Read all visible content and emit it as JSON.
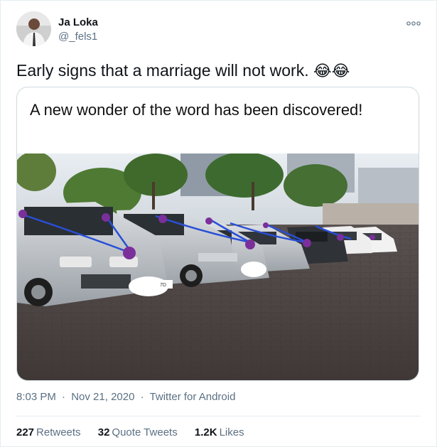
{
  "author": {
    "name": "Ja Loka",
    "handle": "@_fels1"
  },
  "tweet": {
    "text": "Early signs that a marriage will not work.",
    "emojis": [
      "😂",
      "😂"
    ]
  },
  "media": {
    "caption": "A new wonder of the word has been discovered!",
    "photo_icon": "cars-with-wedding-ribbons-photo",
    "plate_text": "7D"
  },
  "meta": {
    "time": "8:03 PM",
    "date": "Nov 21, 2020",
    "source": "Twitter for Android",
    "separator": "·"
  },
  "stats": {
    "retweets_count": "227",
    "retweets_label": "Retweets",
    "quotes_count": "32",
    "quotes_label": "Quote Tweets",
    "likes_count": "1.2K",
    "likes_label": "Likes"
  },
  "colors": {
    "text_primary": "#0f1419",
    "text_secondary": "#5b7083",
    "border": "#cfd9de",
    "ribbon": "#2a4fd6",
    "bow": "#7a2f9a"
  }
}
